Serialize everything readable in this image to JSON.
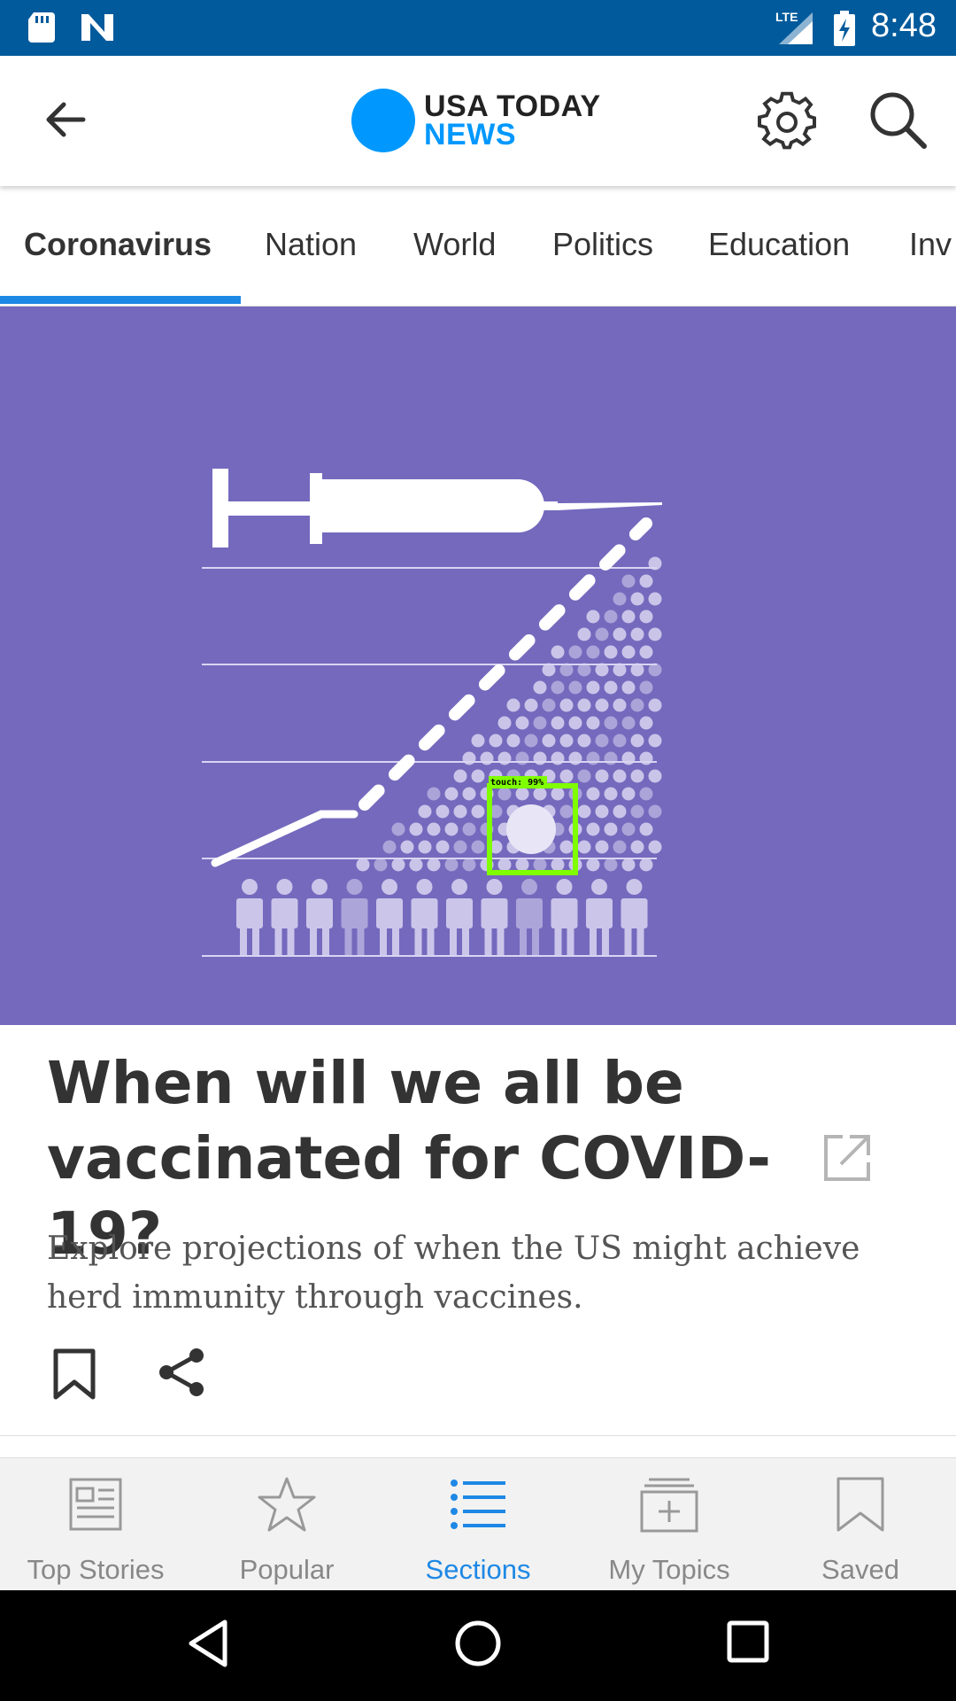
{
  "status_bar": {
    "time": "8:48",
    "network": "LTE",
    "icons": [
      "sd-card-icon",
      "n-logo-icon",
      "lte-signal-icon",
      "battery-charging-icon"
    ]
  },
  "app_bar": {
    "logo_line1": "USA TODAY",
    "logo_line2": "NEWS",
    "icons": [
      "back-arrow-icon",
      "gear-icon",
      "search-icon"
    ]
  },
  "tabs": [
    {
      "label": "Coronavirus",
      "active": true
    },
    {
      "label": "Nation",
      "active": false
    },
    {
      "label": "World",
      "active": false
    },
    {
      "label": "Politics",
      "active": false
    },
    {
      "label": "Education",
      "active": false
    },
    {
      "label": "Inv",
      "active": false
    }
  ],
  "hero": {
    "background_color": "#7469bd",
    "overlay_label": "touch: 99%"
  },
  "article": {
    "headline": "When will we all be vaccinated for COVID-19?",
    "summary": "Explore projections of when the US might achieve herd immunity through vaccines.",
    "icons": [
      "external-link-icon",
      "bookmark-icon",
      "share-icon"
    ]
  },
  "bottom_nav": [
    {
      "label": "Top Stories",
      "icon": "newspaper-icon",
      "active": false
    },
    {
      "label": "Popular",
      "icon": "star-icon",
      "active": false
    },
    {
      "label": "Sections",
      "icon": "list-icon",
      "active": true
    },
    {
      "label": "My Topics",
      "icon": "add-topic-icon",
      "active": false
    },
    {
      "label": "Saved",
      "icon": "bookmark-icon",
      "active": false
    }
  ],
  "colors": {
    "status_bar": "#005a9c",
    "accent": "#1e88e5",
    "logo_blue": "#0098fe",
    "detection_box": "#7fff00"
  }
}
